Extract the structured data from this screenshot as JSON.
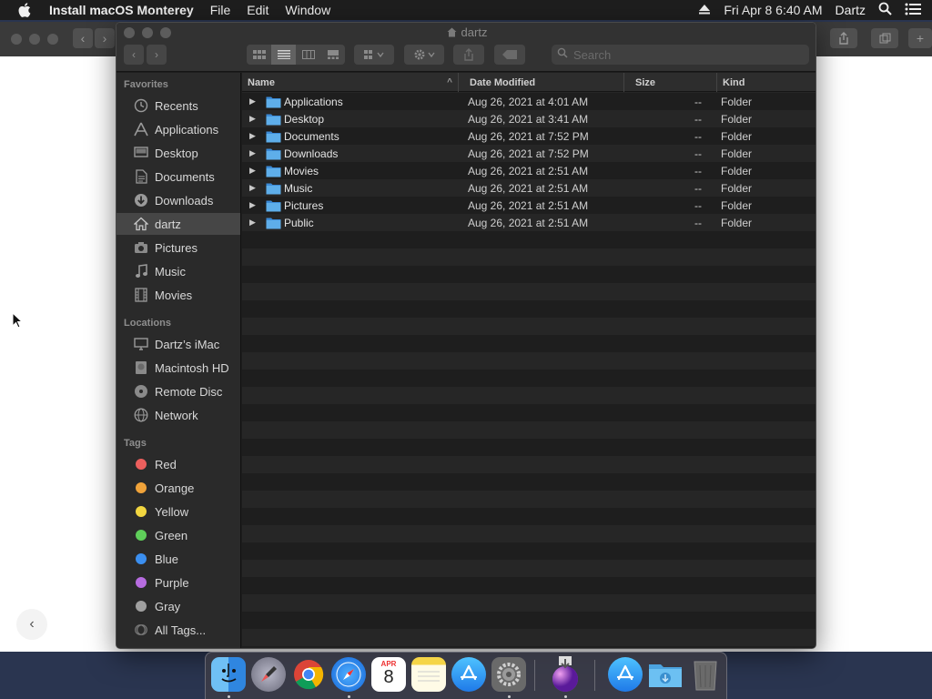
{
  "menubar": {
    "app_name": "Install macOS Monterey",
    "menus": [
      "File",
      "Edit",
      "Window"
    ],
    "clock": "Fri Apr 8  6:40 AM",
    "user": "Dartz"
  },
  "finder": {
    "title": "dartz",
    "search_placeholder": "Search",
    "sidebar": {
      "favorites_header": "Favorites",
      "favorites": [
        {
          "label": "Recents",
          "icon": "clock-icon"
        },
        {
          "label": "Applications",
          "icon": "applications-icon"
        },
        {
          "label": "Desktop",
          "icon": "desktop-icon"
        },
        {
          "label": "Documents",
          "icon": "document-icon"
        },
        {
          "label": "Downloads",
          "icon": "download-icon"
        },
        {
          "label": "dartz",
          "icon": "home-icon"
        },
        {
          "label": "Pictures",
          "icon": "camera-icon"
        },
        {
          "label": "Music",
          "icon": "music-note-icon"
        },
        {
          "label": "Movies",
          "icon": "film-icon"
        }
      ],
      "locations_header": "Locations",
      "locations": [
        {
          "label": "Dartz’s iMac",
          "icon": "computer-icon"
        },
        {
          "label": "Macintosh HD",
          "icon": "hard-drive-icon"
        },
        {
          "label": "Remote Disc",
          "icon": "disc-icon"
        },
        {
          "label": "Network",
          "icon": "globe-icon"
        }
      ],
      "tags_header": "Tags",
      "tags": [
        {
          "label": "Red",
          "color": "#ec5f5d"
        },
        {
          "label": "Orange",
          "color": "#f0a33a"
        },
        {
          "label": "Yellow",
          "color": "#f2d640"
        },
        {
          "label": "Green",
          "color": "#5fce5a"
        },
        {
          "label": "Blue",
          "color": "#3b8ff0"
        },
        {
          "label": "Purple",
          "color": "#b76ce0"
        },
        {
          "label": "Gray",
          "color": "#a0a0a0"
        },
        {
          "label": "All Tags...",
          "color": ""
        }
      ]
    },
    "columns": {
      "name": "Name",
      "date": "Date Modified",
      "size": "Size",
      "kind": "Kind"
    },
    "files": [
      {
        "name": "Applications",
        "date": "Aug 26, 2021 at 4:01 AM",
        "size": "--",
        "kind": "Folder"
      },
      {
        "name": "Desktop",
        "date": "Aug 26, 2021 at 3:41 AM",
        "size": "--",
        "kind": "Folder"
      },
      {
        "name": "Documents",
        "date": "Aug 26, 2021 at 7:52 PM",
        "size": "--",
        "kind": "Folder"
      },
      {
        "name": "Downloads",
        "date": "Aug 26, 2021 at 7:52 PM",
        "size": "--",
        "kind": "Folder"
      },
      {
        "name": "Movies",
        "date": "Aug 26, 2021 at 2:51 AM",
        "size": "--",
        "kind": "Folder"
      },
      {
        "name": "Music",
        "date": "Aug 26, 2021 at 2:51 AM",
        "size": "--",
        "kind": "Folder"
      },
      {
        "name": "Pictures",
        "date": "Aug 26, 2021 at 2:51 AM",
        "size": "--",
        "kind": "Folder"
      },
      {
        "name": "Public",
        "date": "Aug 26, 2021 at 2:51 AM",
        "size": "--",
        "kind": "Folder"
      }
    ]
  },
  "dock": {
    "apps": [
      "finder-icon",
      "launchpad-icon",
      "chrome-icon",
      "safari-icon",
      "calendar-icon",
      "notes-icon",
      "app-store-icon",
      "system-preferences-icon",
      "install-macos-icon",
      "app-store-downloads-icon",
      "downloads-folder-icon",
      "trash-icon"
    ],
    "calendar_month": "APR",
    "calendar_day": "8"
  }
}
